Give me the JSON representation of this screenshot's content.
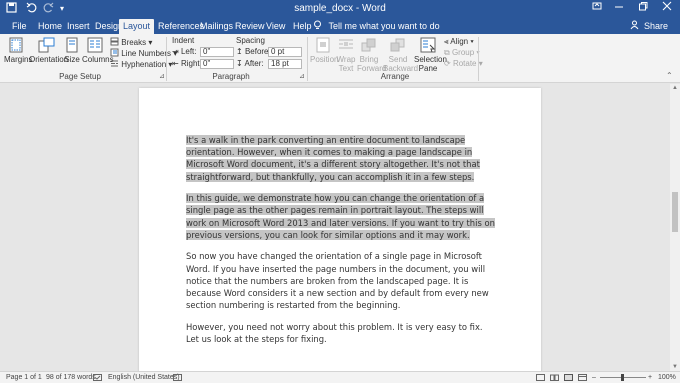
{
  "window": {
    "title": "sample_docx - Word"
  },
  "qat": {
    "save_icon": "save-icon",
    "undo_icon": "undo-icon",
    "redo_icon": "redo-icon",
    "customize": "▾"
  },
  "tabs": [
    "File",
    "Home",
    "Insert",
    "Design",
    "Layout",
    "References",
    "Mailings",
    "Review",
    "View",
    "Help"
  ],
  "active_tab": "Layout",
  "tell_me": "Tell me what you want to do",
  "share": "Share",
  "ribbon": {
    "page_setup": {
      "margins": "Margins",
      "orientation": "Orientation",
      "size": "Size",
      "columns": "Columns",
      "breaks": "Breaks",
      "line_numbers": "Line Numbers",
      "hyphenation": "Hyphenation",
      "label": "Page Setup"
    },
    "paragraph": {
      "indent": "Indent",
      "spacing": "Spacing",
      "left_label": "Left:",
      "left_value": "0\"",
      "right_label": "Right:",
      "right_value": "0\"",
      "before_label": "Before:",
      "before_value": "0 pt",
      "after_label": "After:",
      "after_value": "18 pt",
      "label": "Paragraph"
    },
    "arrange": {
      "position": "Position",
      "wrap_text_1": "Wrap",
      "wrap_text_2": "Text",
      "bring_forward_1": "Bring",
      "bring_forward_2": "Forward",
      "send_backward_1": "Send",
      "send_backward_2": "Backward",
      "selection_pane_1": "Selection",
      "selection_pane_2": "Pane",
      "align": "Align",
      "group": "Group",
      "rotate": "Rotate",
      "label": "Arrange"
    }
  },
  "document": {
    "p1": "It's a walk in the park converting an entire document to landscape orientation. However, when it comes to making a page landscape in Microsoft Word document, it's a different story altogether. It's not that straightforward, but thankfully, you can accomplish it in a few steps.",
    "p2": "In this guide, we demonstrate how you can change the orientation of a single page as the other pages remain in portrait layout. The steps will work on Microsoft Word 2013 and later versions. If you want to try this on previous versions, you can look for similar options and it may work.",
    "p3": "So now you have changed the orientation of a single page in Microsoft Word. If you have inserted the page numbers in the document, you will notice that the numbers are broken from the landscaped page. It is because Word considers it a new section and by default from every new section numbering is restarted from the beginning.",
    "p4": "However, you need not worry about this problem. It is very easy to fix. Let us look at the steps for fixing."
  },
  "status": {
    "page": "Page 1 of 1",
    "words": "98 of 178 words",
    "language": "English (United States)",
    "zoom_minus": "–",
    "zoom_plus": "+",
    "zoom": "100%"
  }
}
